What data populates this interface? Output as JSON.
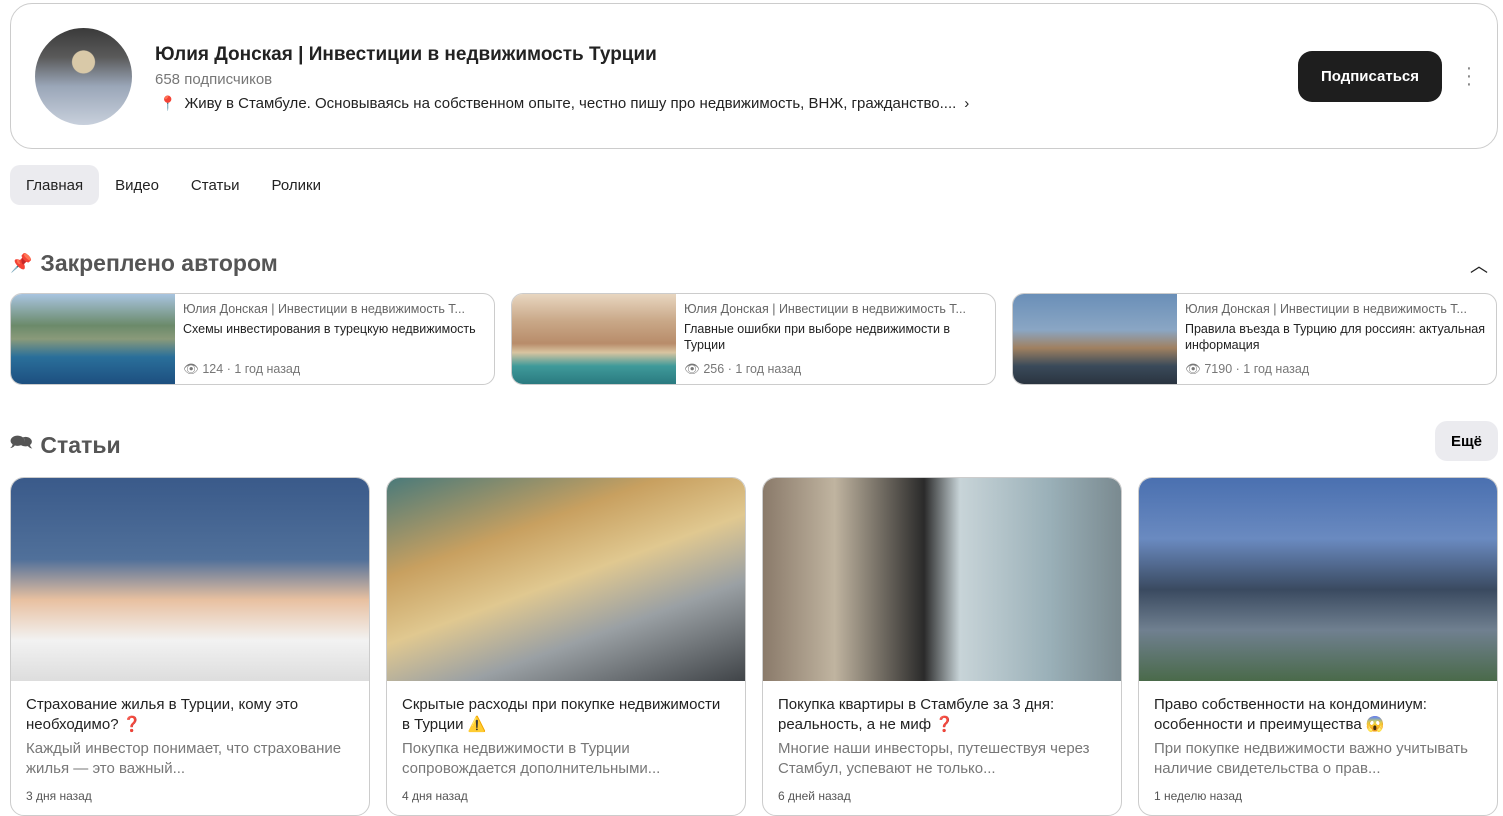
{
  "channel": {
    "title": "Юлия Донская | Инвестиции в недвижимость Турции",
    "subscribers": "658 подписчиков",
    "description": "Живу в Стамбуле. Основываясь на собственном опыте, честно пишу про недвижимость, ВНЖ, гражданство....",
    "subscribe_label": "Подписаться"
  },
  "tabs": [
    "Главная",
    "Видео",
    "Статьи",
    "Ролики"
  ],
  "pinned": {
    "heading": "Закреплено автором",
    "items": [
      {
        "author": "Юлия Донская | Инвестиции в недвижимость Т...",
        "title": "Схемы инвестирования в турецкую недвижимость",
        "views": "124",
        "age": "1 год назад"
      },
      {
        "author": "Юлия Донская | Инвестиции в недвижимость Т...",
        "title": "Главные ошибки при выборе недвижимости в Турции",
        "views": "256",
        "age": "1 год назад"
      },
      {
        "author": "Юлия Донская | Инвестиции в недвижимость Т...",
        "title": "Правила въезда в Турцию для россиян: актуальная информация",
        "views": "7190",
        "age": "1 год назад"
      }
    ]
  },
  "articles": {
    "heading": "Статьи",
    "more_label": "Ещё",
    "items": [
      {
        "title": "Страхование жилья в Турции, кому это необходимо?",
        "emoji": "❓",
        "desc": "Каждый инвестор понимает, что страхование жилья — это важный...",
        "date": "3 дня назад"
      },
      {
        "title": "Скрытые расходы при покупке недвижимости в Турции",
        "emoji": "⚠️",
        "desc": "Покупка недвижимости в Турции сопровождается дополнительными...",
        "date": "4 дня назад"
      },
      {
        "title": "Покупка квартиры в Стамбуле за 3 дня: реальность, а не миф",
        "emoji": "❓",
        "desc": "Многие наши инвесторы, путешествуя через Стамбул, успевают не только...",
        "date": "6 дней назад"
      },
      {
        "title": "Право собственности на кондоминиум: особенности и преимущества",
        "emoji": "😱",
        "desc": "При покупке недвижимости важно учитывать наличие свидетельства о прав...",
        "date": "1 неделю назад"
      }
    ]
  }
}
